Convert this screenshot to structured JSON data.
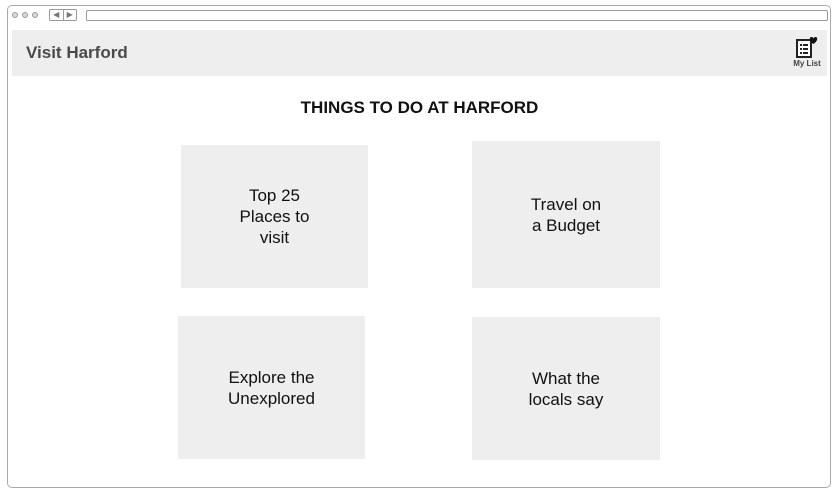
{
  "header": {
    "site_title": "Visit Harford",
    "my_list_label": "My List"
  },
  "main": {
    "heading": "THINGS TO DO AT HARFORD",
    "tiles": [
      {
        "label": "Top 25\nPlaces to\nvisit"
      },
      {
        "label": "Travel on\na Budget"
      },
      {
        "label": "Explore the\nUnexplored"
      },
      {
        "label": "What the\nlocals say"
      }
    ]
  },
  "colors": {
    "header_bg": "#eeeeee",
    "tile_bg": "#eeeeee",
    "title_text": "#4a4a4a",
    "heading_text": "#111111"
  },
  "icons": {
    "my_list": "list-heart-icon"
  }
}
